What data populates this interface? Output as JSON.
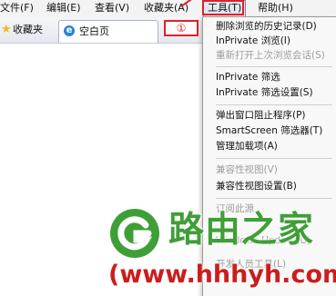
{
  "menubar": {
    "file": "文件(F)",
    "edit": "编辑(E)",
    "view": "查看(V)",
    "favorites": "收藏夹(A)",
    "tools": "工具(T)",
    "help": "帮助(H)"
  },
  "favorites_button": "收藏夹",
  "tab": {
    "label": "空白页"
  },
  "callout_badge": "①",
  "tools_menu": {
    "items": [
      {
        "label": "删除浏览的历史记录(D)",
        "enabled": true
      },
      {
        "label": "InPrivate 浏览(I)",
        "enabled": true
      },
      {
        "label": "重新打开上次浏览会话(S)",
        "enabled": false
      },
      {
        "label": "InPrivate 筛选",
        "enabled": true
      },
      {
        "label": "InPrivate 筛选设置(S)",
        "enabled": true
      },
      {
        "label": "弹出窗口阻止程序(P)",
        "enabled": true
      },
      {
        "label": "SmartScreen 筛选器(T)",
        "enabled": true
      },
      {
        "label": "管理加载项(A)",
        "enabled": true
      },
      {
        "label": "兼容性视图(V)",
        "enabled": false
      },
      {
        "label": "兼容性视图设置(B)",
        "enabled": true
      },
      {
        "label": "订阅此源",
        "enabled": false
      },
      {
        "label": "Windows Update(U)",
        "enabled": false
      },
      {
        "label": "开发人员工具(L)",
        "enabled": false
      }
    ]
  },
  "watermark": {
    "title": "路由之家",
    "url": "(www.hhhyh.com)"
  },
  "colors": {
    "highlight_red": "#e0202c",
    "watermark_green": "#3f9f37",
    "watermark_red": "#cc1d1d"
  }
}
